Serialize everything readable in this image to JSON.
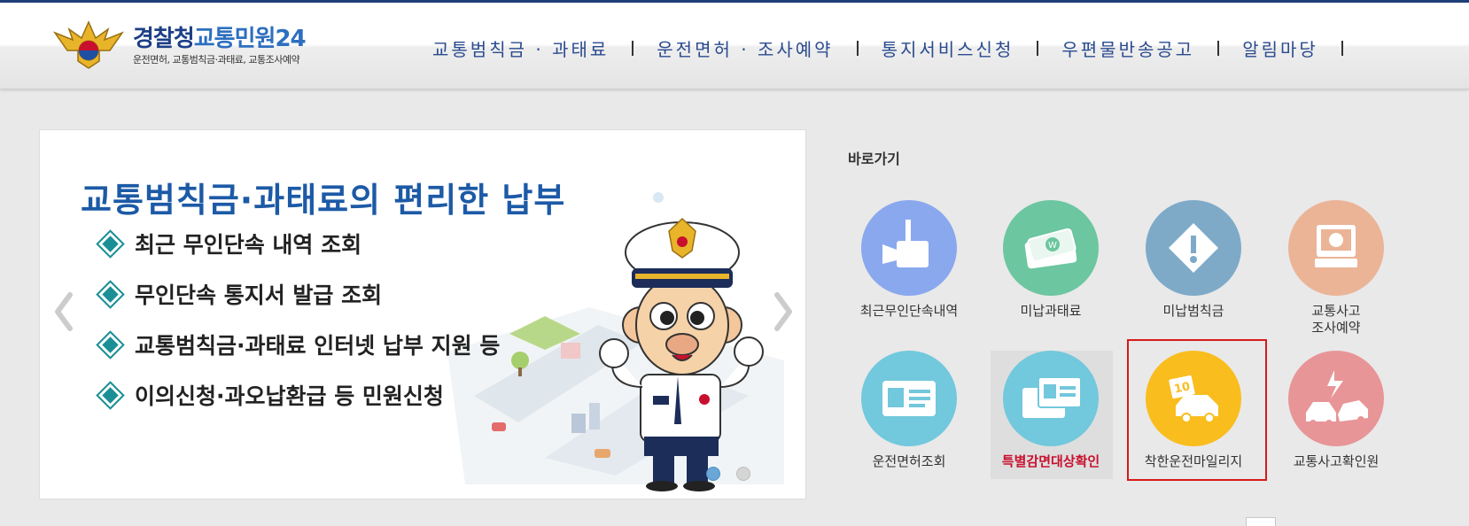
{
  "header": {
    "logo_title_main": "경찰청",
    "logo_title_accent": "교통민원24",
    "logo_subtitle": "운전면허, 교통범칙금·과태료, 교통조사예약"
  },
  "nav": {
    "items": [
      {
        "label": "교통범칙금 · 과태료"
      },
      {
        "label": "운전면허 · 조사예약"
      },
      {
        "label": "통지서비스신청"
      },
      {
        "label": "우편물반송공고"
      },
      {
        "label": "알림마당"
      }
    ]
  },
  "banner": {
    "title": "교통범칙금·과태료의 편리한 납부",
    "bullets": [
      "최근 무인단속 내역 조회",
      "무인단속 통지서 발급 조회",
      "교통범칙금·과태료 인터넷 납부 지원 등",
      "이의신청·과오납환급 등 민원신청"
    ],
    "slide_count": 2,
    "active_slide": 1
  },
  "quick": {
    "title": "바로가기",
    "items": [
      {
        "label": "최근무인단속내역",
        "color": "#8aa8ee",
        "icon": "camera-icon"
      },
      {
        "label": "미납과태료",
        "color": "#6cc6a0",
        "icon": "money-icon"
      },
      {
        "label": "미납범칙금",
        "color": "#7eaac8",
        "icon": "warning-icon"
      },
      {
        "label": "교통사고\n조사예약",
        "color": "#ebb497",
        "icon": "monitor-icon"
      },
      {
        "label": "운전면허조회",
        "color": "#72c8dc",
        "icon": "license-card-icon"
      },
      {
        "label": "특별감면대상확인",
        "color": "#72c8dc",
        "icon": "cards-icon"
      },
      {
        "label": "착한운전마일리지",
        "color": "#f9bd1e",
        "icon": "mileage-car-icon"
      },
      {
        "label": "교통사고확인원",
        "color": "#e89598",
        "icon": "car-crash-icon"
      }
    ]
  }
}
